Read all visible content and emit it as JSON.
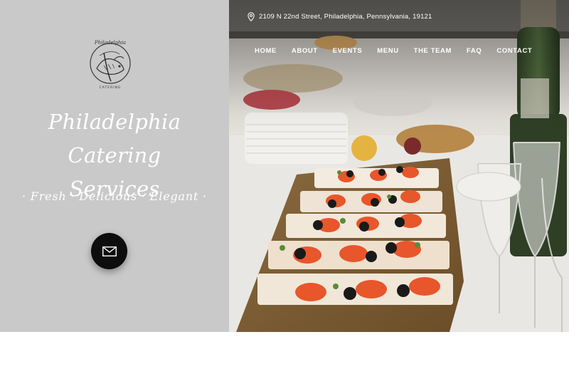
{
  "brand": {
    "logo_text": "Philadelphia",
    "logo_subtext": "CATERING",
    "title_line1": "Philadelphia Catering",
    "title_line2": "Services",
    "tagline": "· Fresh · Delicious · Elegant ·"
  },
  "contact": {
    "address": "2109 N 22nd Street, Philadelphia, Pennsylvania, 19121"
  },
  "nav": {
    "items": [
      {
        "label": "HOME"
      },
      {
        "label": "ABOUT"
      },
      {
        "label": "EVENTS"
      },
      {
        "label": "MENU"
      },
      {
        "label": "THE TEAM"
      },
      {
        "label": "FAQ"
      },
      {
        "label": "CONTACT"
      }
    ]
  },
  "icons": {
    "mail": "mail-icon",
    "location": "location-pin-icon"
  },
  "colors": {
    "left_panel": "#c9c9c9",
    "button": "#0d0d0d",
    "text": "#ffffff"
  }
}
